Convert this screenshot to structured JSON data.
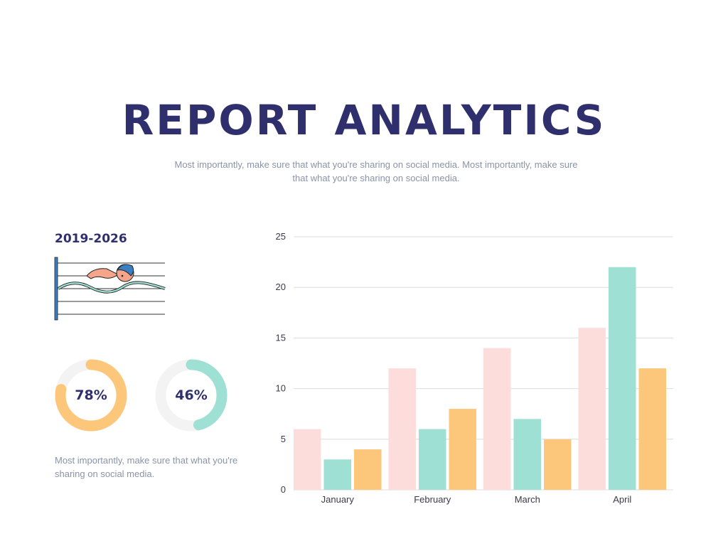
{
  "header": {
    "title": "REPORT ANALYTICS",
    "subtitle": "Most importantly, make sure that what you're sharing on social media. Most importantly, make sure that what you're sharing on social media."
  },
  "left_panel": {
    "period": "2019-2026",
    "illustration": "swimmer-icon",
    "donuts": [
      {
        "label": "78%",
        "value": 78,
        "color": "#fdc77b"
      },
      {
        "label": "46%",
        "value": 46,
        "color": "#9ee0d3"
      }
    ],
    "caption": "Most importantly, make sure that what you're sharing on social media."
  },
  "chart_data": {
    "type": "bar",
    "categories": [
      "January",
      "February",
      "March",
      "April"
    ],
    "series": [
      {
        "values": [
          6,
          12,
          14,
          16
        ],
        "color": "#fddcdc"
      },
      {
        "values": [
          3,
          6,
          7,
          22
        ],
        "color": "#9ee0d3"
      },
      {
        "values": [
          4,
          8,
          5,
          12
        ],
        "color": "#fdc77b"
      }
    ],
    "ylim": [
      0,
      25
    ],
    "yticks": [
      0,
      5,
      10,
      15,
      20,
      25
    ],
    "grid": true,
    "legend": "none",
    "title": "",
    "xlabel": "",
    "ylabel": ""
  }
}
